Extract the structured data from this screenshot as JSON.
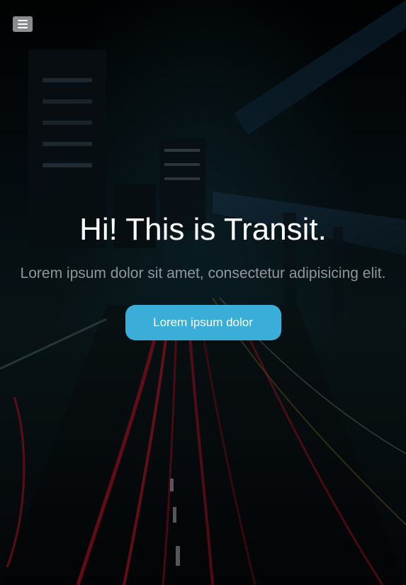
{
  "header": {
    "menu_toggle_icon": "menu-icon"
  },
  "hero": {
    "title": "Hi! This is Transit.",
    "subtitle": "Lorem ipsum dolor sit amet, consectetur adipisicing elit.",
    "cta_label": "Lorem ipsum dolor",
    "colors": {
      "accent": "#3aaed8",
      "text": "#ffffff"
    }
  }
}
